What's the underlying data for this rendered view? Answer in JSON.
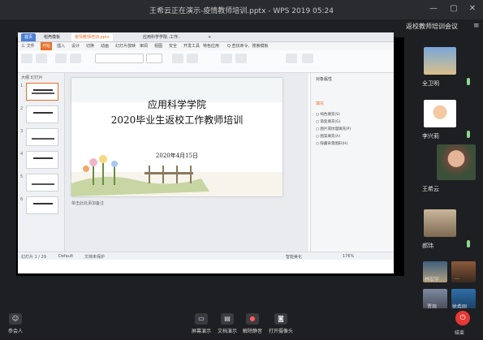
{
  "window": {
    "title": "王希云正在演示-疫情教师培训.pptx - WPS 2019 05:24"
  },
  "sidebar": {
    "title": "返校教师培训会议",
    "participants": [
      {
        "name": "全卫明"
      },
      {
        "name": "李兴莉"
      },
      {
        "name": "王希云"
      },
      {
        "name": "郝玮"
      }
    ],
    "mini": [
      "林宏宇",
      "…",
      "贾茵",
      "徐希刚"
    ]
  },
  "wps": {
    "tabs": [
      "首页",
      "稻壳模板",
      "疫情教师培训.pptx",
      "应用科学学院..工作..",
      "+"
    ],
    "menus": [
      "三 文件",
      "开始",
      "插入",
      "设计",
      "切换",
      "动画",
      "幻灯片放映",
      "审阅",
      "视图",
      "安全",
      "开发工具",
      "特色应用",
      "Q 查找命令、搜索模板"
    ],
    "panel_tabs": "大纲  幻灯片",
    "slide_title_1": "应用科学学院",
    "slide_title_2": "2020毕业生返校工作教师培训",
    "slide_date": "2020年4月15日",
    "notes": "单击此处添加备注",
    "props_title": "对象属性",
    "props_fill": "填充",
    "props_options": [
      "纯色填充(S)",
      "渐变填充(G)",
      "图片或纹理填充(P)",
      "图案填充(A)",
      "隐藏背景图形(H)"
    ],
    "status_items": [
      "幻灯片 1 / 29",
      "Default",
      "文档未保护",
      "智能美化",
      "176%"
    ]
  },
  "toolbar": {
    "participants": "参会人",
    "share": "屏幕演示",
    "doc": "文档演示",
    "mute": "解除静音",
    "camera": "打开摄像头",
    "end": "结束"
  }
}
